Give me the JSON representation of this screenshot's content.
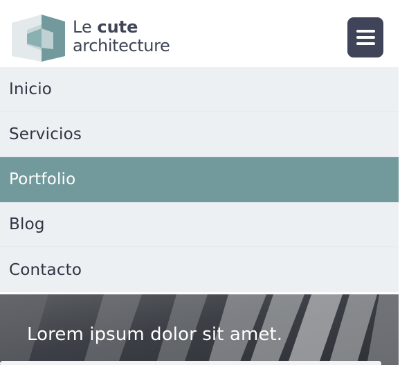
{
  "brand": {
    "line1_light": "Le",
    "line1_strong": "cute",
    "line2": "architecture",
    "colors": {
      "mark_teal": "#729a9c",
      "mark_light": "#dfe7e8",
      "text": "#3f4456"
    }
  },
  "header": {
    "menu_button": {
      "icon": "hamburger-icon",
      "color": "#3f4459"
    }
  },
  "nav": {
    "items": [
      {
        "label": "Inicio",
        "active": false
      },
      {
        "label": "Servicios",
        "active": false
      },
      {
        "label": "Portfolio",
        "active": true
      },
      {
        "label": "Blog",
        "active": false
      },
      {
        "label": "Contacto",
        "active": false
      }
    ],
    "colors": {
      "background": "#edf0f3",
      "active": "#729a9c"
    }
  },
  "hero": {
    "heading": "Lorem ipsum dolor sit amet."
  }
}
